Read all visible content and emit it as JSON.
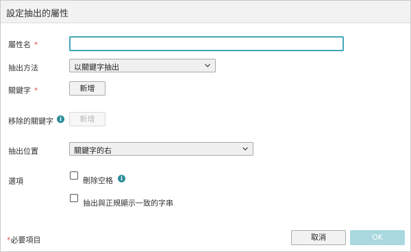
{
  "dialog": {
    "title": "設定抽出的屬性"
  },
  "form": {
    "attribute_name": {
      "label": "屬性名",
      "required_mark": "*",
      "value": ""
    },
    "extract_method": {
      "label": "抽出方法",
      "selected": "以關鍵字抽出"
    },
    "keyword": {
      "label": "關鍵字",
      "required_mark": "*",
      "add_button": "新增"
    },
    "remove_keyword": {
      "label": "移除的關鍵字",
      "add_button": "新增",
      "add_button_disabled": true
    },
    "extract_position": {
      "label": "抽出位置",
      "selected": "關鍵字的右"
    },
    "options": {
      "label": "選項",
      "items": [
        {
          "label": "刪除空格",
          "checked": false
        },
        {
          "label": "抽出與正規顯示一致的字串",
          "checked": false
        }
      ]
    }
  },
  "footer": {
    "required_note_mark": "*",
    "required_note": "必要項目",
    "cancel_label": "取消",
    "ok_label": "OK"
  },
  "colors": {
    "accent": "#3fa7b6",
    "required": "#d9534f",
    "info_icon": "#2a8c9a",
    "ok_disabled": "#a9d8df"
  },
  "icons": [
    "info-icon",
    "chevron-down-icon"
  ]
}
